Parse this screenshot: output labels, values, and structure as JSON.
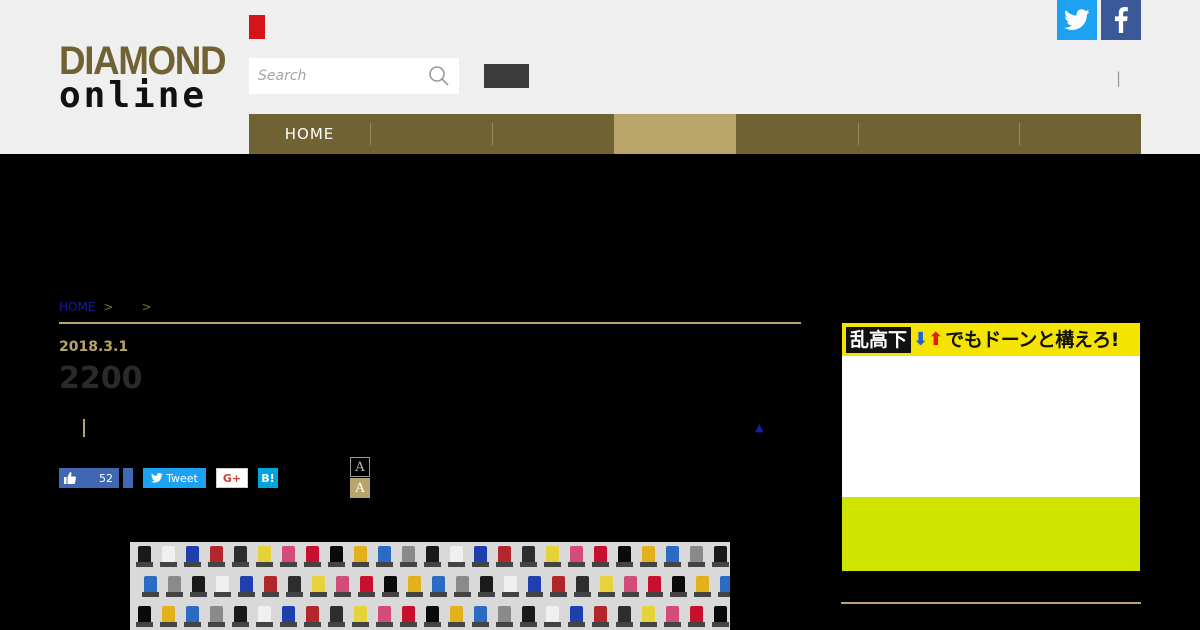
{
  "header": {
    "logo_line1": "DIAMOND",
    "logo_line2": "online",
    "search_placeholder": "Search",
    "separator": "|"
  },
  "nav": {
    "items": [
      {
        "label": "HOME",
        "active": false
      },
      {
        "label": "",
        "active": false
      },
      {
        "label": "",
        "active": false
      },
      {
        "label": "",
        "active": true
      },
      {
        "label": "",
        "active": false
      },
      {
        "label": "",
        "active": false
      },
      {
        "label": "",
        "active": false
      }
    ]
  },
  "breadcrumb": {
    "home": "HOME",
    "sep1": ">",
    "sep2": ">"
  },
  "article": {
    "date": "2018.3.1",
    "title": "2200",
    "up_arrow": "▲"
  },
  "share": {
    "like_count": "52",
    "tweet_label": "Tweet",
    "gplus_label": "G+",
    "hatena_label": "B!",
    "font_small": "A",
    "font_large": "A"
  },
  "ad": {
    "boxed_text": "乱高下",
    "arrow_down": "⬇",
    "arrow_up": "⬆",
    "tagline": "でもドーンと構えろ!"
  },
  "colors": {
    "brand_gold": "#716233",
    "accent_gold": "#b9a46a",
    "twitter": "#1da1f2",
    "facebook": "#3b5998",
    "ad_yellow": "#f5e400",
    "ad_lime": "#cfe500"
  }
}
